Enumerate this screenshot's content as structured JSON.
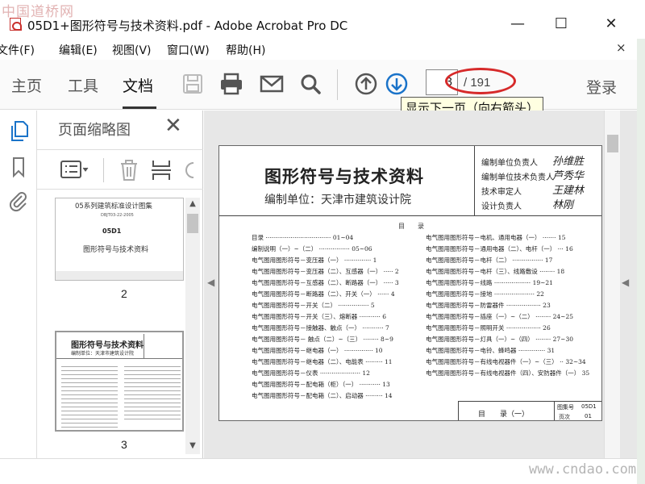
{
  "watermark_top": "中国道桥网",
  "watermark_bottom": "www.cndao.com",
  "window": {
    "title": "05D1+图形符号与技术资料.pdf - Adobe Acrobat Pro DC",
    "minimize": "—",
    "maximize": "☐",
    "close": "✕"
  },
  "menu": {
    "items": [
      "文件(F)",
      "编辑(E)",
      "视图(V)",
      "窗口(W)",
      "帮助(H)"
    ],
    "close": "×"
  },
  "toolbar": {
    "tabs": [
      "主页",
      "工具",
      "文档"
    ],
    "active_tab": "文档",
    "icons": [
      "save-icon",
      "print-icon",
      "email-icon",
      "search-icon",
      "previous-page-icon",
      "next-page-icon"
    ],
    "page_current": "3",
    "page_total": "/ 191",
    "login": "登录",
    "tooltip": "显示下一页（向右箭头）"
  },
  "left_strip": {
    "icons": [
      "pages-icon",
      "bookmark-icon",
      "attachment-icon"
    ]
  },
  "thumbnails_panel": {
    "title": "页面缩略图",
    "close": "✕",
    "tools": [
      "options-icon",
      "delete-icon",
      "insert-page-icon",
      "rotate-icon"
    ],
    "thumbs": [
      {
        "label": "2",
        "header": "05系列建筑标准设计图集",
        "code": "DBJT03-22-2005",
        "name": "05D1",
        "subtitle": "图形符号与技术资料"
      },
      {
        "label": "3",
        "header": "图形符号与技术资料",
        "subtitle": "编制单位：天津市建筑设计院"
      }
    ]
  },
  "document": {
    "title": "图形符号与技术资料",
    "unit": "编制单位：天津市建筑设计院",
    "responsibles": [
      {
        "role": "编制单位负责人",
        "sign": "孙维胜"
      },
      {
        "role": "编制单位技术负责人",
        "sign": "芦秀华"
      },
      {
        "role": "技术审定人",
        "sign": "王建林"
      },
      {
        "role": "设计负责人",
        "sign": "林刚"
      }
    ],
    "toc_heading": "目　　录",
    "toc_left": [
      "目录 ·································· 01~04",
      "编制说明（一）~（二） ················ 05~06",
      "电气图用图形符号－变压器（一） ·············· 1",
      "电气图用图形符号－变压器（二）、互感器（一） ····· 2",
      "电气图用图形符号－互感器（二）、断路器（一） ····· 3",
      "电气图用图形符号－断路器（二）、开关（一） ······ 4",
      "电气图用图形符号－开关（二） ················ 5",
      "电气图用图形符号－开关（三）、熔断器 ··········· 6",
      "电气图用图形符号－接触器、触点（一） ··········· 7",
      "电气图用图形符号－ 触点（二）~（三） ········ 8~9",
      "电气图用图形符号－继电器（一） ··············· 10",
      "电气图用图形符号－继电器（二）、电能表 ········· 11",
      "电气图用图形符号－仪表 ····················· 12",
      "电气图用图形符号－配电箱（柜）（一） ··········· 13",
      "电气图用图形符号－配电箱（二）、启动器 ········· 14"
    ],
    "toc_right": [
      "电气图用图形符号－电机、通用电器（一） ······· 15",
      "电气图用图形符号－通用电器（二）、电杆（一） ··· 16",
      "电气图用图形符号－电杆（二） ················ 17",
      "电气图用图形符号－电杆（三）、线路敷设 ········ 18",
      "电气图用图形符号－线路 ··················· 19~21",
      "电气图用图形符号－接地 ····················· 22",
      "电气图用图形符号－防雷器件 ·················· 23",
      "电气图用图形符号－插座（一）~（二） ········ 24~25",
      "电气图用图形符号－照明开关 ·················· 26",
      "电气图用图形符号－灯具（一）~（四） ········ 27~30",
      "电气图用图形符号－电铃、蜂鸣器 ·············· 31",
      "电气图用图形符号－有线电视器件（一）~（三） ·· 32~34",
      "电气图用图形符号－有线电视器件（四）、安防器件（一） 35"
    ],
    "footer_label": "目　　录（一）",
    "footer_atlas_label": "图集号",
    "footer_atlas_value": "05D1",
    "footer_page_label": "页次",
    "footer_page_value": "01"
  }
}
